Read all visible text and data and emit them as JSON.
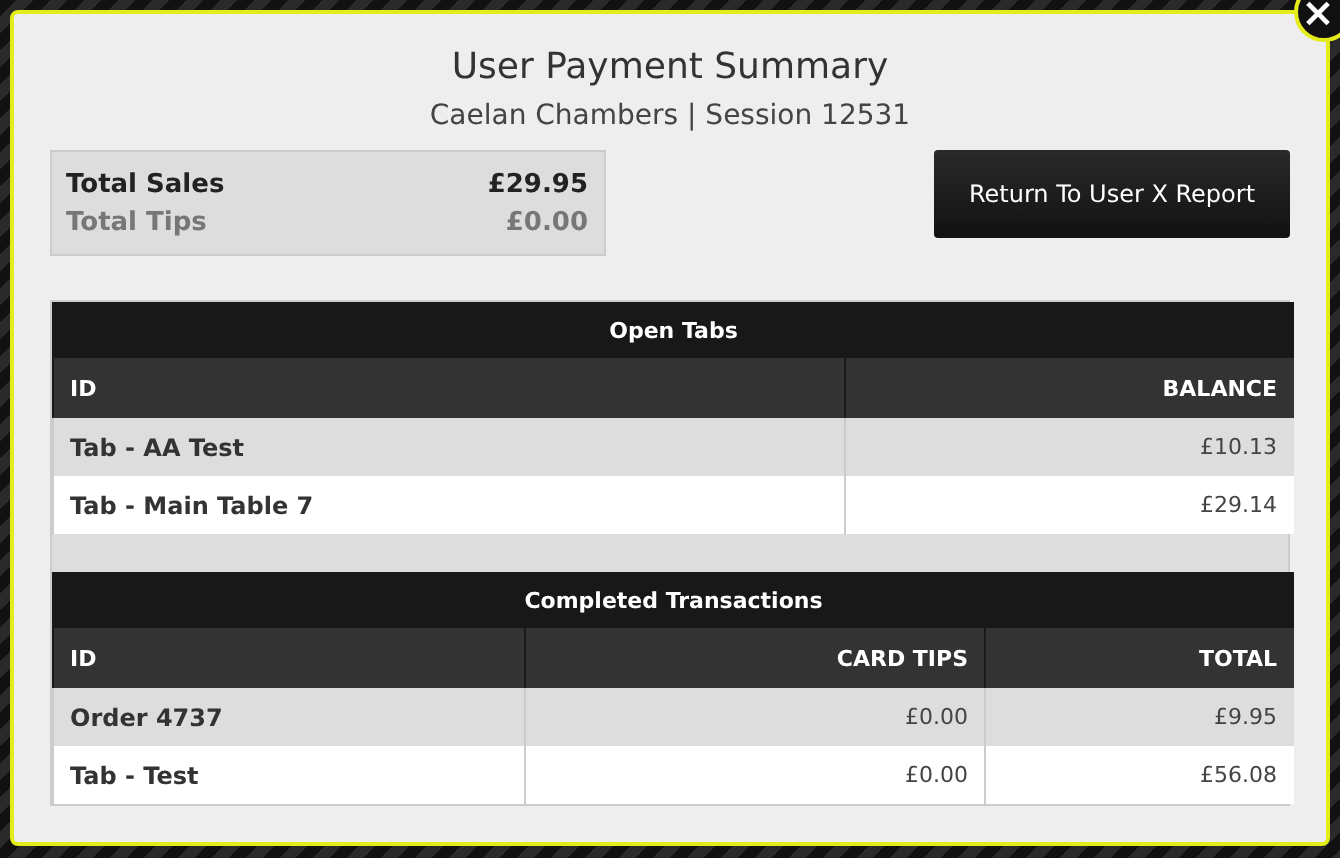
{
  "dialog": {
    "title": "User Payment Summary",
    "subtitle": "Caelan Chambers | Session 12531",
    "close": "×"
  },
  "summary": [
    {
      "label": "Total Sales",
      "value": "£29.95",
      "kind": "primary"
    },
    {
      "label": "Total Tips",
      "value": "£0.00",
      "kind": "secondary"
    }
  ],
  "return_button": "Return To User X Report",
  "tables": [
    {
      "title": "Open Tabs",
      "columns": [
        "ID",
        "BALANCE"
      ],
      "rows": [
        [
          "Tab - AA Test",
          "£10.13"
        ],
        [
          "Tab - Main Table 7",
          "£29.14"
        ]
      ]
    },
    {
      "title": "Completed Transactions",
      "columns": [
        "ID",
        "CARD TIPS",
        "TOTAL"
      ],
      "rows": [
        [
          "Order 4737",
          "£0.00",
          "£9.95"
        ],
        [
          "Tab - Test",
          "£0.00",
          "£56.08"
        ]
      ]
    }
  ]
}
